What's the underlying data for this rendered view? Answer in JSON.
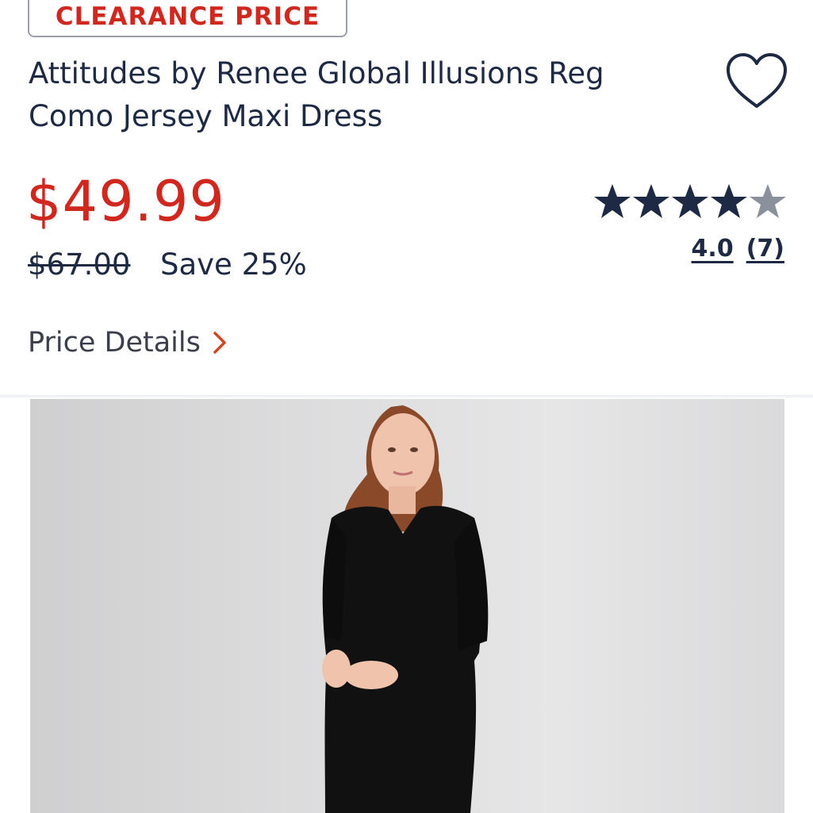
{
  "badge": {
    "label": "CLEARANCE PRICE"
  },
  "product": {
    "title_line1": "Attitudes by Renee Global Illusions Reg",
    "title_line2": "Como Jersey Maxi Dress"
  },
  "pricing": {
    "current": "$49.99",
    "original": "$67.00",
    "savings": "Save 25%",
    "details_link": "Price Details"
  },
  "rating": {
    "stars_value": 4.0,
    "stars_max": 5,
    "score": "4.0",
    "count": "(7)"
  },
  "colors": {
    "accent_red": "#d0281f",
    "text_navy": "#1e2a44",
    "star_filled": "#1e2a44",
    "star_empty": "#8a909c",
    "chevron": "#d0481f"
  },
  "icons": {
    "wishlist": "heart-outline-icon",
    "details": "chevron-right-icon",
    "stars": "star-icon"
  }
}
